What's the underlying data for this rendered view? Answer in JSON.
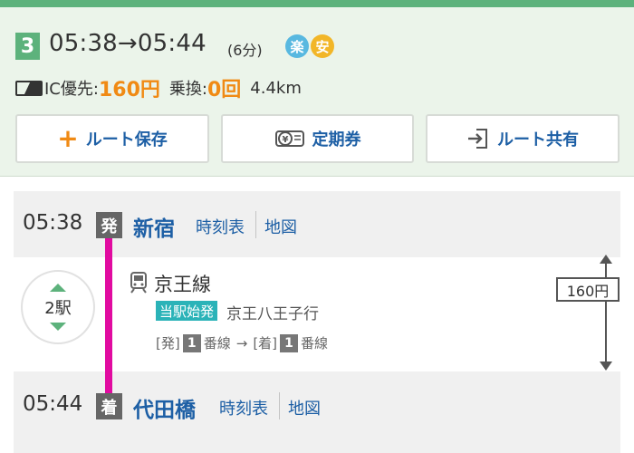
{
  "summary": {
    "route_number": "3",
    "time_range": "05:38→05:44",
    "duration": "(6分)",
    "badges": [
      "楽",
      "安"
    ],
    "colors": {
      "accent_green": "#5db27c",
      "orange": "#f08a14",
      "link_blue": "#1d5fa5",
      "line_magenta": "#e10ba0",
      "badge_raku": "#58b8e0",
      "badge_an": "#f2b628"
    }
  },
  "fare": {
    "ic_label": "IC優先:",
    "fare_value": "160円",
    "transfer_label": "乗換:",
    "transfer_value": "0回",
    "distance": "4.4km"
  },
  "actions": {
    "save_label": "ルート保存",
    "teiki_label": "定期券",
    "share_label": "ルート共有",
    "save_icon": "plus-icon",
    "teiki_icon": "yen-ticket-icon",
    "share_icon": "share-icon"
  },
  "departure": {
    "time": "05:38",
    "mark": "発",
    "station": "新宿",
    "timetable_link": "時刻表",
    "map_link": "地図"
  },
  "segment": {
    "stops": "2駅",
    "line_name": "京王線",
    "start_badge": "当駅始発",
    "destination": "京王八王子行",
    "dep_label": "[発]",
    "dep_track": "1",
    "track_suffix": "番線",
    "arrow": "→",
    "arr_label": "[着]",
    "arr_track": "1",
    "fare": "160円"
  },
  "arrival": {
    "time": "05:44",
    "mark": "着",
    "station": "代田橋",
    "timetable_link": "時刻表",
    "map_link": "地図"
  }
}
